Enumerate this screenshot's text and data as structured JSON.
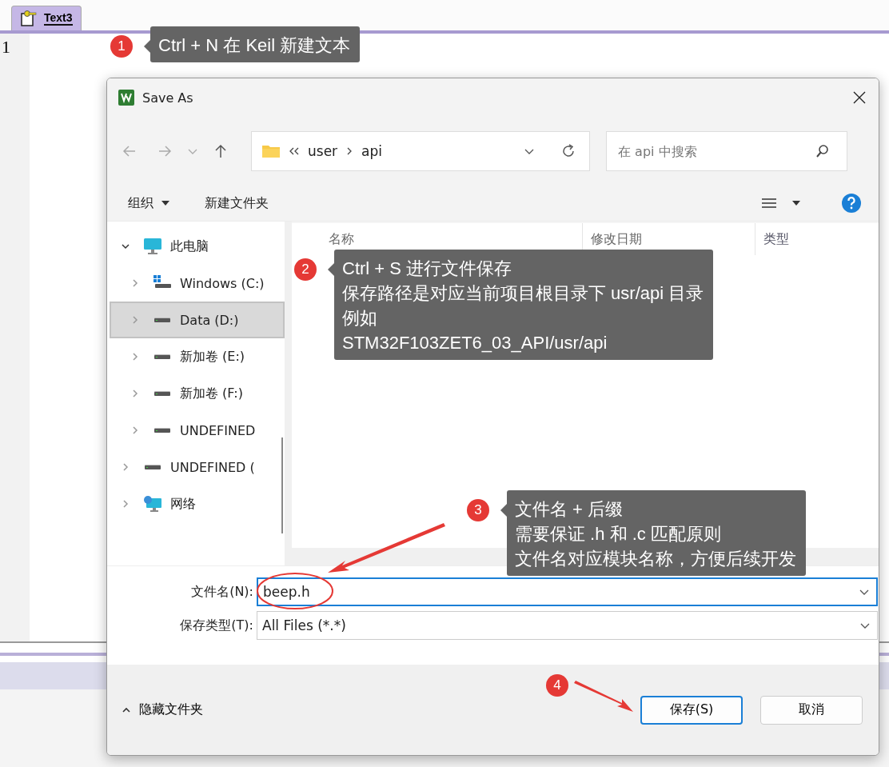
{
  "editor": {
    "tab": {
      "label": "Text3",
      "selected": true
    },
    "line_numbers": [
      "1"
    ]
  },
  "dialog": {
    "title": "Save As",
    "address": {
      "path": [
        "user",
        "api"
      ]
    },
    "search": {
      "placeholder": "在 api 中搜索"
    },
    "toolbar": {
      "organize": "组织",
      "new_folder": "新建文件夹"
    },
    "tree": [
      {
        "kind": "pc",
        "label": "此电脑",
        "expanded": true,
        "selected": false,
        "children": [
          {
            "kind": "windows-drive",
            "label": "Windows (C:)",
            "expanded": false,
            "selected": false
          },
          {
            "kind": "drive",
            "label": "Data (D:)",
            "expanded": false,
            "selected": true
          },
          {
            "kind": "drive",
            "label": "新加卷 (E:)",
            "expanded": false,
            "selected": false
          },
          {
            "kind": "drive",
            "label": "新加卷 (F:)",
            "expanded": false,
            "selected": false
          },
          {
            "kind": "drive",
            "label": "UNDEFINED",
            "expanded": false,
            "selected": false
          }
        ]
      },
      {
        "kind": "drive",
        "label": "UNDEFINED (",
        "expanded": false,
        "selected": false
      },
      {
        "kind": "network",
        "label": "网络",
        "expanded": false,
        "selected": false
      }
    ],
    "columns": [
      "名称",
      "修改日期",
      "类型"
    ],
    "fields": [
      {
        "label": "文件名(N):",
        "value": "beep.h"
      },
      {
        "label": "保存类型(T):",
        "value": "All Files (*.*)"
      }
    ],
    "hide_folders": "隐藏文件夹",
    "buttons": [
      {
        "label": "保存(S)",
        "default": true
      },
      {
        "label": "取消",
        "default": false
      }
    ]
  },
  "annotations": [
    {
      "number": "1",
      "lines": [
        "Ctrl + N 在 Keil 新建文本"
      ]
    },
    {
      "number": "2",
      "lines": [
        "Ctrl + S 进行文件保存",
        "保存路径是对应当前项目根目录下 usr/api 目录",
        "例如",
        "STM32F103ZET6_03_API/usr/api"
      ]
    },
    {
      "number": "3",
      "lines": [
        "文件名 + 后缀",
        "需要保证 .h 和 .c 匹配原则",
        "文件名对应模块名称，方便后续开发"
      ]
    },
    {
      "number": "4"
    }
  ]
}
